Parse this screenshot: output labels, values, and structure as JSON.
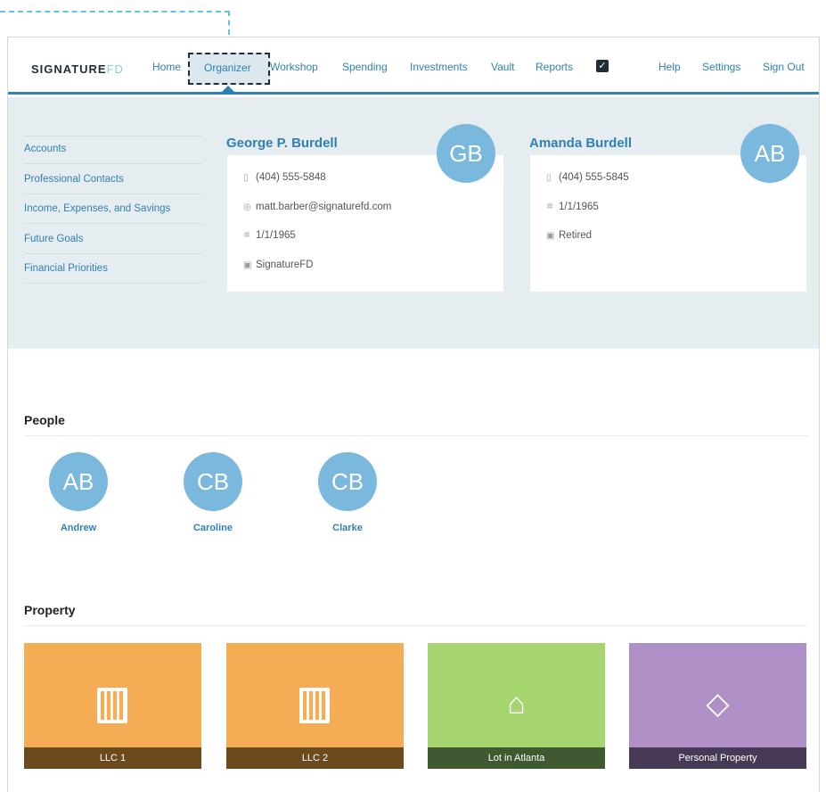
{
  "nav": {
    "logo_main": "SIGNATURE",
    "logo_accent": "FD",
    "items": [
      "Home",
      "Organizer",
      "Workshop",
      "Spending",
      "Investments",
      "Vault",
      "Reports",
      "Help",
      "Settings",
      "Sign Out"
    ],
    "active": "Organizer"
  },
  "sidebar": {
    "links": [
      "Accounts",
      "Professional Contacts",
      "Income, Expenses, and Savings",
      "Future Goals",
      "Financial Priorities"
    ]
  },
  "primary": {
    "name": "George P. Burdell",
    "initials": "GB",
    "phone": "(404) 555-5848",
    "email": "matt.barber@signaturefd.com",
    "dob": "1/1/1965",
    "employer": "SignatureFD"
  },
  "spouse": {
    "name": "Amanda Burdell",
    "initials": "AB",
    "phone": "(404) 555-5845",
    "dob": "1/1/1965",
    "employer": "Retired"
  },
  "people": {
    "title": "People",
    "list": [
      {
        "initials": "AB",
        "name": "Andrew"
      },
      {
        "initials": "CB",
        "name": "Caroline"
      },
      {
        "initials": "CB",
        "name": "Clarke"
      }
    ]
  },
  "property": {
    "title": "Property",
    "tiles": [
      {
        "label": "LLC 1",
        "icon": "building-icon",
        "color": "#f5ad55",
        "label_bg": "#6b4a1e"
      },
      {
        "label": "LLC 2",
        "icon": "building-icon",
        "color": "#f5ad55",
        "label_bg": "#6b4a1e"
      },
      {
        "label": "Lot in Atlanta",
        "icon": "house-icon",
        "color": "#a6d56f",
        "label_bg": "#3f5a30"
      },
      {
        "label": "Personal Property",
        "icon": "diamond-icon",
        "color": "#ae8fc6",
        "label_bg": "#473a55"
      }
    ]
  },
  "colors": {
    "accent": "#2f80b5",
    "avatar": "#7ab8de",
    "panel": "#e6edf1"
  }
}
